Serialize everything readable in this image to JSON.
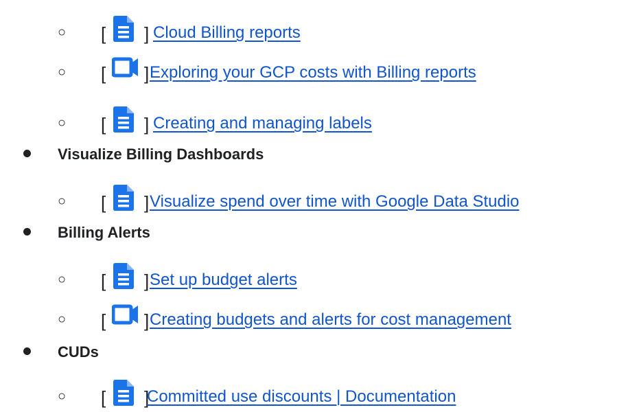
{
  "brand_color": "#1a73e8",
  "link_color": "#1155cc",
  "items": [
    {
      "kind": "sub",
      "icon": "document-icon",
      "bracket_open": "[",
      "bracket_close": "]",
      "link": "Cloud Billing reports"
    },
    {
      "kind": "sub",
      "icon": "video-icon",
      "bracket_open": "[",
      "bracket_close": "]",
      "link": "Exploring your GCP costs with Billing reports"
    },
    {
      "kind": "sub",
      "icon": "document-icon",
      "bracket_open": "[",
      "bracket_close": "]",
      "link": "Creating and managing labels"
    },
    {
      "kind": "top",
      "label": "Visualize Billing Dashboards"
    },
    {
      "kind": "sub",
      "icon": "document-icon",
      "bracket_open": "[",
      "bracket_close": "]",
      "link": "Visualize spend over time with Google Data Studio"
    },
    {
      "kind": "top",
      "label": "Billing Alerts"
    },
    {
      "kind": "sub",
      "icon": "document-icon",
      "bracket_open": "[",
      "bracket_close": "]",
      "link": "Set up budget alerts"
    },
    {
      "kind": "sub",
      "icon": "video-icon",
      "bracket_open": "[",
      "bracket_close": "]",
      "link": "Creating budgets and alerts for cost management"
    },
    {
      "kind": "top",
      "label": "CUDs"
    },
    {
      "kind": "sub",
      "icon": "document-icon",
      "bracket_open": "[",
      "bracket_close": "]",
      "link": "Committed use discounts | Documentation"
    }
  ],
  "bullets": {
    "sub": "○"
  }
}
